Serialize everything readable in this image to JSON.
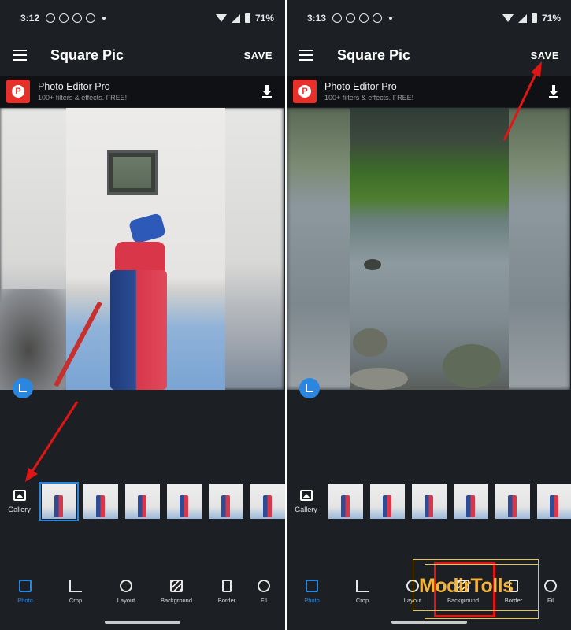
{
  "colors": {
    "background": "#1c1f24",
    "accent": "#2b86e0",
    "highlight": "#e01616",
    "watermark": "#f2b43b"
  },
  "screens": [
    {
      "status": {
        "time": "3:12",
        "battery": "71%"
      },
      "app_title": "Square Pic",
      "save_label": "SAVE",
      "ad": {
        "title": "Photo Editor Pro",
        "subtitle": "100+ filters & effects. FREE!"
      },
      "gallery_label": "Gallery",
      "tools": [
        "Photo",
        "Crop",
        "Layout",
        "Background",
        "Border",
        "Fil"
      ]
    },
    {
      "status": {
        "time": "3:13",
        "battery": "71%"
      },
      "app_title": "Square Pic",
      "save_label": "SAVE",
      "ad": {
        "title": "Photo Editor Pro",
        "subtitle": "100+ filters & effects. FREE!"
      },
      "gallery_label": "Gallery",
      "tools": [
        "Photo",
        "Crop",
        "Layout",
        "Background",
        "Border",
        "Fil"
      ]
    }
  ],
  "watermark": "ModirTolls",
  "icons": [
    "menu-icon",
    "download-icon",
    "resize-icon",
    "gallery-icon",
    "photo-icon",
    "crop-icon",
    "layout-icon",
    "background-icon",
    "border-icon",
    "filter-icon"
  ]
}
